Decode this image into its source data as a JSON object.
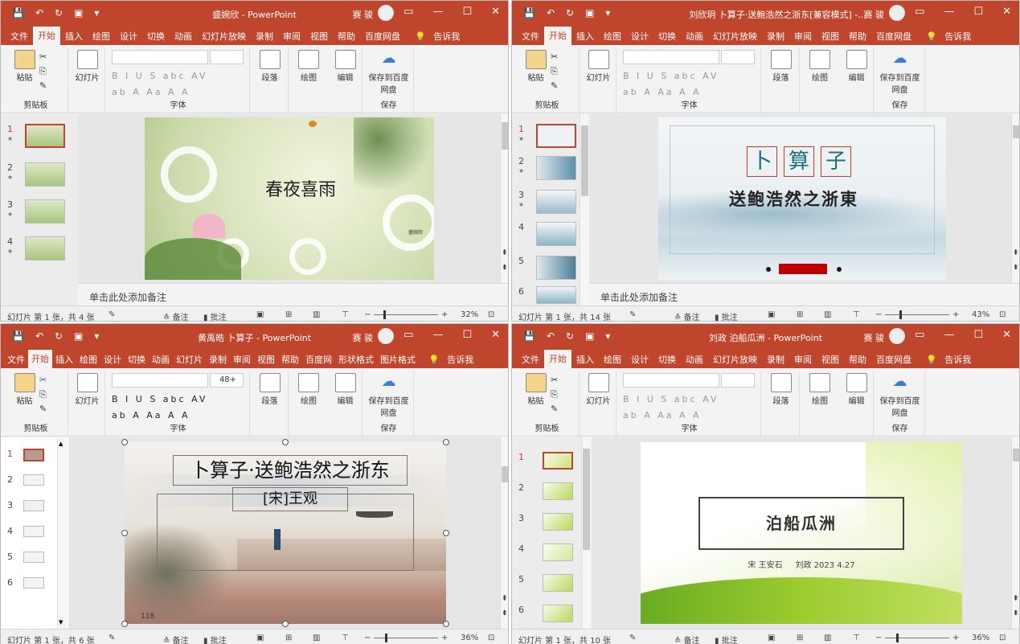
{
  "ribbon": {
    "tabs_full": [
      "文件",
      "开始",
      "插入",
      "绘图",
      "设计",
      "切换",
      "动画",
      "幻灯片放映",
      "录制",
      "审阅",
      "视图",
      "帮助",
      "百度网盘"
    ],
    "tabs_compact": [
      "文件",
      "开始",
      "插入",
      "绘图",
      "设计",
      "切换",
      "动画",
      "幻灯片",
      "录制",
      "审阅",
      "视图",
      "帮助",
      "百度网",
      "形状格式",
      "图片格式"
    ],
    "tell_me": "告诉我",
    "paste": "粘贴",
    "clipboard": "剪贴板",
    "slides": "幻灯片",
    "font_group": "字体",
    "paragraph": "段落",
    "drawing": "绘图",
    "editing": "编辑",
    "save_to_baidu": "保存到百度网盘",
    "save_group": "保存",
    "font_size_w3": "48+"
  },
  "windows": [
    {
      "title": "盛婉欣 - PowerPoint",
      "user": "赛 骏",
      "slide_title": "春夜喜雨",
      "slide_author": "盛婉欣",
      "notes": "单击此处添加备注",
      "status_slide": "幻灯片 第 1 张，共 4 张",
      "zoom": "32%",
      "slide_count_listed": 4
    },
    {
      "title": "刘欣玥 卜算子·送鲍浩然之浙东[兼容模式] -...",
      "user": "赛 骏",
      "slide_title": "卜算子",
      "slide_subtitle": "送鲍浩然之浙東",
      "notes": "单击此处添加备注",
      "status_slide": "幻灯片 第 1 张，共 14 张",
      "zoom": "43%",
      "slide_count_listed": 6
    },
    {
      "title": "黄禹皓 卜算子 - PowerPoint",
      "user": "赛 骏",
      "slide_title": "卜算子·送鲍浩然之浙东",
      "slide_subtitle": "[宋]王观",
      "slide_number": "118",
      "status_slide": "幻灯片 第 1 张，共 6 张",
      "zoom": "36%",
      "slide_count_listed": 6
    },
    {
      "title": "刘政 泊船瓜洲 - PowerPoint",
      "user": "赛 骏",
      "slide_title": "泊船瓜洲",
      "slide_subtitle": "宋 王安石     刘政 2023 4.27",
      "status_slide": "幻灯片 第 1 张，共 10 张",
      "zoom": "36%",
      "slide_count_listed": 6
    }
  ],
  "status": {
    "notes_label": "备注",
    "comments_label": "批注"
  },
  "colors": {
    "accent": "#c0452d",
    "red_bar": "#c00000"
  }
}
